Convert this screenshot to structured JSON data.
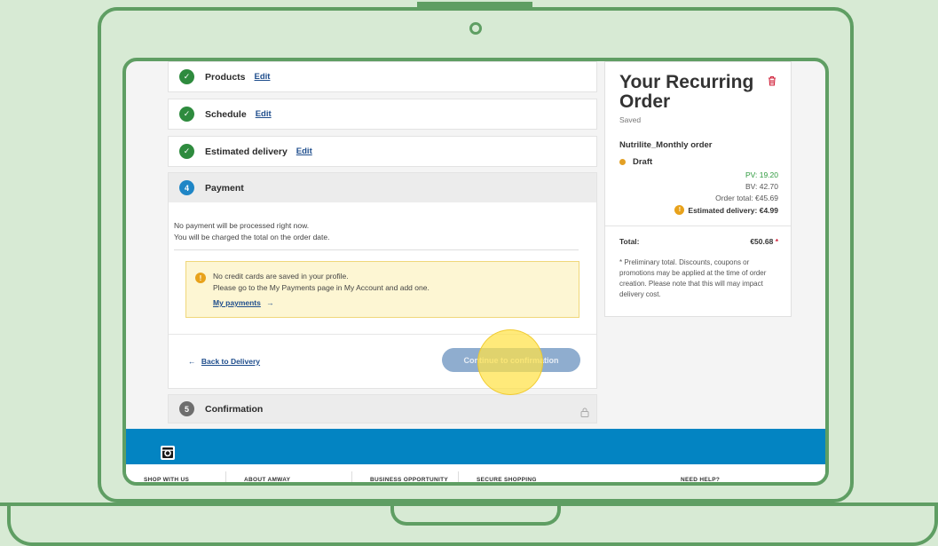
{
  "steps": [
    {
      "title": "Products",
      "edit": "Edit"
    },
    {
      "title": "Schedule",
      "edit": "Edit"
    },
    {
      "title": "Estimated delivery",
      "edit": "Edit"
    }
  ],
  "payment": {
    "number": "4",
    "title": "Payment",
    "line1": "No payment will be processed right now.",
    "line2": "You will be charged the total on the order date.",
    "warning_line1": "No credit cards are saved in your profile.",
    "warning_line2": "Please go to the My Payments page in My Account and add one.",
    "warning_link": "My payments",
    "warning_link_arrow": "→",
    "back_arrow": "←",
    "back_label": "Back to Delivery",
    "continue_label": "Continue to confirmation"
  },
  "confirmation": {
    "number": "5",
    "title": "Confirmation"
  },
  "summary": {
    "title": "Your Recurring Order",
    "saved": "Saved",
    "order_name": "Nutrilite_Monthly order",
    "status": "Draft",
    "pv": "PV: 19.20",
    "bv": "BV: 42.70",
    "order_total": "Order total: €45.69",
    "estimated_delivery": "Estimated delivery: €4.99",
    "total_label": "Total:",
    "total_value": "€50.68",
    "total_star": "*",
    "note": "* Preliminary total. Discounts, coupons or promotions may be applied at the time of order creation. Please note that this will may impact delivery cost."
  },
  "footer": {
    "links": [
      "SHOP WITH US",
      "ABOUT AMWAY",
      "BUSINESS OPPORTUNITY",
      "SECURE SHOPPING",
      "NEED HELP?"
    ]
  },
  "colors": {
    "frame": "#5f9e63",
    "background": "#d7ead4",
    "done": "#2e8b3e",
    "active": "#1f86c6",
    "footer_blue": "#0384c2",
    "highlight": "#ffe246"
  }
}
